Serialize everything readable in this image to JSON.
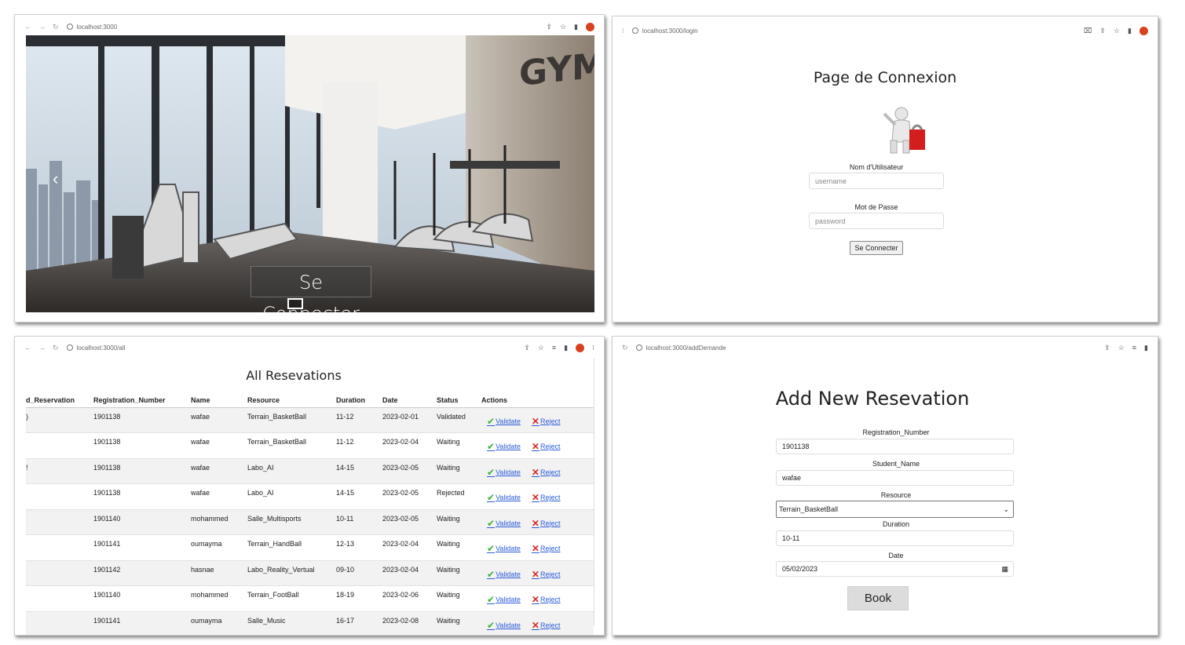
{
  "panel_home": {
    "url": "localhost:3000",
    "caption": "Se Connecter",
    "prev_glyph": "‹",
    "wall_sign": "GYM"
  },
  "panel_login": {
    "url": "localhost:3000/login",
    "title": "Page de Connexion",
    "username_label": "Nom d'Utilisateur",
    "username_placeholder": "username",
    "password_label": "Mot de Passe",
    "password_placeholder": "password",
    "submit_label": "Se Connecter"
  },
  "panel_all": {
    "url": "localhost:3000/all",
    "title": "All Resevations",
    "columns": [
      "d_Reservation",
      "Registration_Number",
      "Name",
      "Resource",
      "Duration",
      "Date",
      "Status",
      "Actions"
    ],
    "validate_label": "Validate",
    "reject_label": "Reject",
    "rows": [
      {
        "id": ")",
        "reg": "1901138",
        "name": "wafae",
        "resource": "Terrain_BasketBall",
        "duration": "11-12",
        "date": "2023-02-01",
        "status": "Validated"
      },
      {
        "id": "",
        "reg": "1901138",
        "name": "wafae",
        "resource": "Terrain_BasketBall",
        "duration": "11-12",
        "date": "2023-02-04",
        "status": "Waiting"
      },
      {
        "id": "!",
        "reg": "1901138",
        "name": "wafae",
        "resource": "Labo_AI",
        "duration": "14-15",
        "date": "2023-02-05",
        "status": "Waiting"
      },
      {
        "id": "",
        "reg": "1901138",
        "name": "wafae",
        "resource": "Labo_AI",
        "duration": "14-15",
        "date": "2023-02-05",
        "status": "Rejected"
      },
      {
        "id": "",
        "reg": "1901140",
        "name": "mohammed",
        "resource": "Salle_Multisports",
        "duration": "10-11",
        "date": "2023-02-05",
        "status": "Waiting"
      },
      {
        "id": "",
        "reg": "1901141",
        "name": "oumayma",
        "resource": "Terrain_HandBall",
        "duration": "12-13",
        "date": "2023-02-04",
        "status": "Waiting"
      },
      {
        "id": "",
        "reg": "1901142",
        "name": "hasnae",
        "resource": "Labo_Reality_Vertual",
        "duration": "09-10",
        "date": "2023-02-04",
        "status": "Waiting"
      },
      {
        "id": "",
        "reg": "1901140",
        "name": "mohammed",
        "resource": "Terrain_FootBall",
        "duration": "18-19",
        "date": "2023-02-06",
        "status": "Waiting"
      },
      {
        "id": "",
        "reg": "1901141",
        "name": "oumayma",
        "resource": "Salle_Music",
        "duration": "16-17",
        "date": "2023-02-08",
        "status": "Waiting"
      }
    ]
  },
  "panel_add": {
    "url": "localhost:3000/addDemande",
    "title": "Add New Resevation",
    "reg_label": "Registration_Number",
    "reg_value": "1901138",
    "name_label": "Student_Name",
    "name_value": "wafae",
    "resource_label": "Resource",
    "resource_value": "Terrain_BasketBall",
    "duration_label": "Duration",
    "duration_value": "10-11",
    "date_label": "Date",
    "date_value": "05/02/2023",
    "submit_label": "Book"
  },
  "colors": {
    "link": "#2a5bd7",
    "validate_icon": "#3bb13b",
    "reject_icon": "#d92b2b",
    "browser_avatar": "#d9411e"
  }
}
